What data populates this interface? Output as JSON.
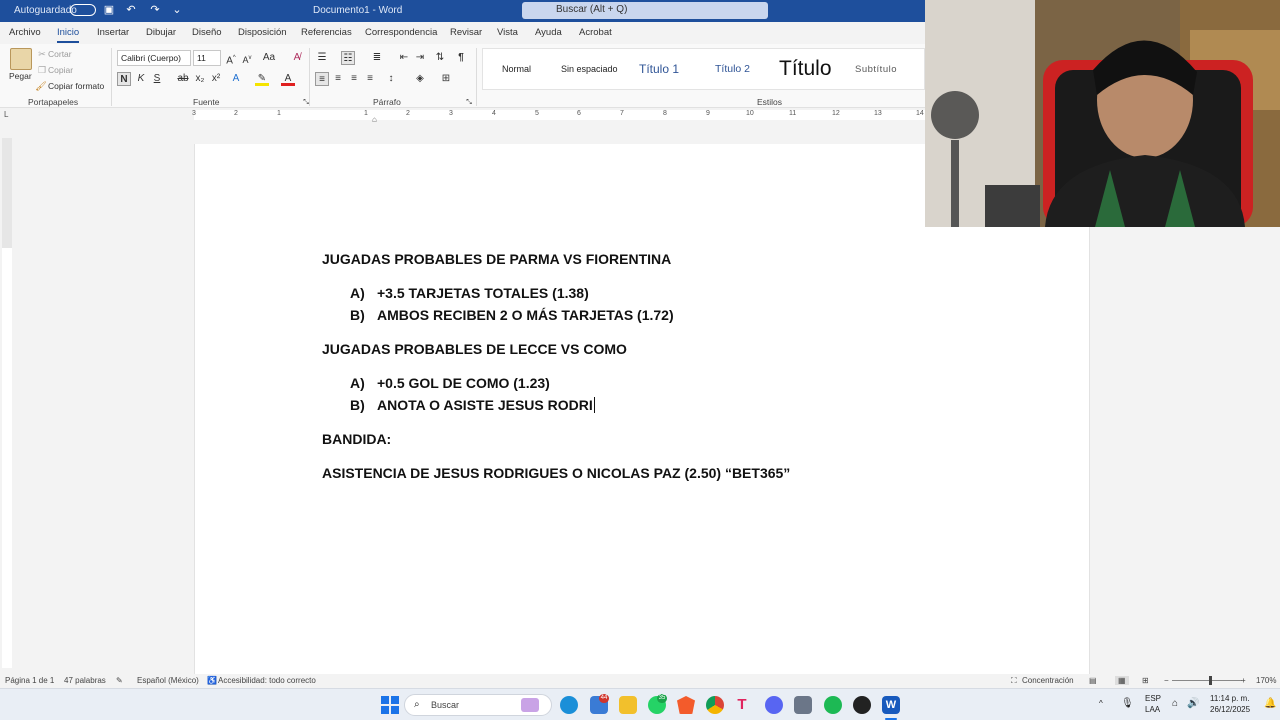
{
  "titlebar": {
    "autosave": "Autoguardado",
    "doc_title": "Documento1 - Word",
    "search_placeholder": "Buscar (Alt + Q)"
  },
  "tabs": [
    "Archivo",
    "Inicio",
    "Insertar",
    "Dibujar",
    "Diseño",
    "Disposición",
    "Referencias",
    "Correspondencia",
    "Revisar",
    "Vista",
    "Ayuda",
    "Acrobat"
  ],
  "active_tab": "Inicio",
  "clipboard": {
    "paste": "Pegar",
    "cut": "Cortar",
    "copy": "Copiar",
    "format_painter": "Copiar formato",
    "label": "Portapapeles"
  },
  "font": {
    "family": "Calibri (Cuerpo)",
    "size": "11",
    "label": "Fuente",
    "bold": "N",
    "italic": "K",
    "underline": "S"
  },
  "paragraph": {
    "label": "Párrafo"
  },
  "styles": {
    "label": "Estilos",
    "items": [
      "Normal",
      "Sin espaciado",
      "Título 1",
      "Título 2",
      "Título",
      "Subtítulo"
    ]
  },
  "ruler_numbers": [
    "3",
    "2",
    "1",
    "1",
    "2",
    "3",
    "4",
    "5",
    "6",
    "7",
    "8",
    "9",
    "10",
    "11",
    "12",
    "13",
    "14"
  ],
  "document": {
    "heading1": "JUGADAS PROBABLES DE PARMA VS FIORENTINA",
    "list1": [
      {
        "marker": "A)",
        "text": "+3.5 TARJETAS TOTALES (1.38)"
      },
      {
        "marker": "B)",
        "text": "AMBOS RECIBEN 2 O MÁS TARJETAS (1.72)"
      }
    ],
    "heading2": "JUGADAS PROBABLES DE LECCE VS COMO",
    "list2": [
      {
        "marker": "A)",
        "text": "+0.5 GOL DE COMO (1.23)"
      },
      {
        "marker": "B)",
        "text": "ANOTA O ASISTE JESUS RODRI"
      }
    ],
    "bandida": "BANDIDA:",
    "final_line": "ASISTENCIA DE JESUS RODRIGUES O NICOLAS PAZ (2.50) “BET365”"
  },
  "status": {
    "page": "Página 1 de 1",
    "words": "47 palabras",
    "language": "Español (México)",
    "accessibility": "Accesibilidad: todo correcto",
    "focus": "Concentración",
    "zoom": "170%"
  },
  "taskbar": {
    "search": "Buscar",
    "lang1": "ESP",
    "lang2": "LAA",
    "time": "11:14 p. m.",
    "date": "26/12/2025",
    "badge_edge": "44",
    "badge_whatsapp": "35"
  }
}
